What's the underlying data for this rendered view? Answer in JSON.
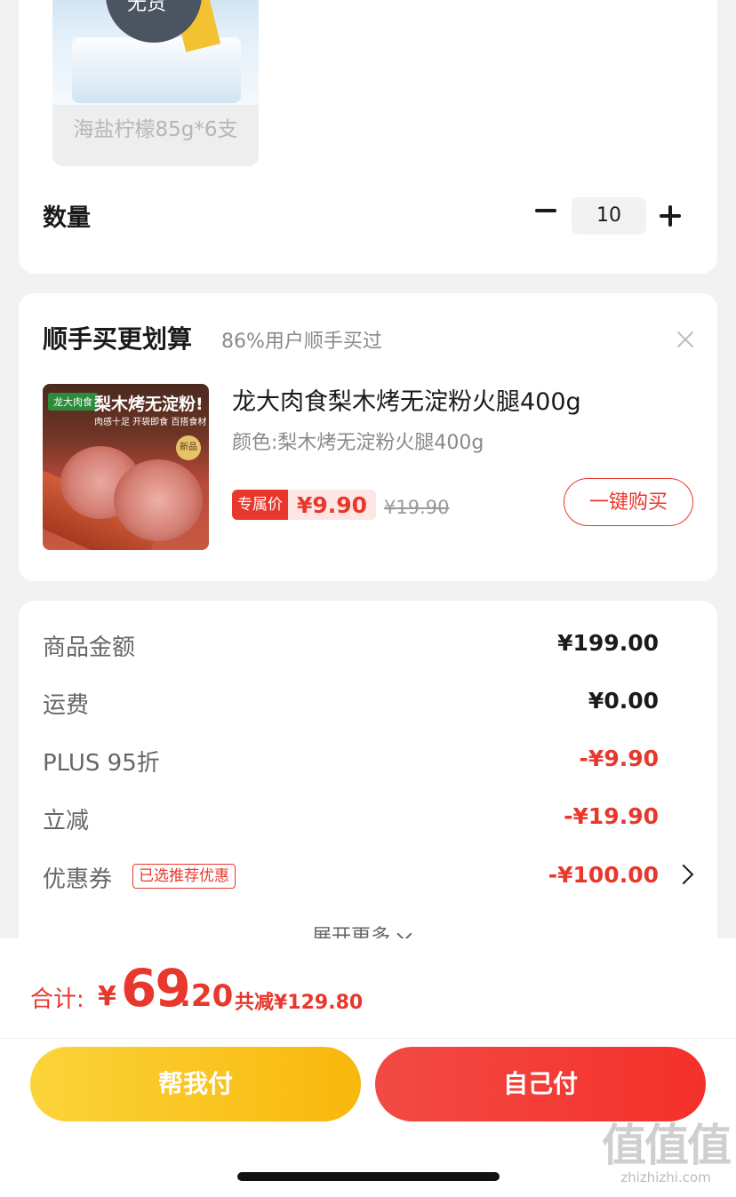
{
  "variant": {
    "badge_text": "无货",
    "label": "海盐柠檬85g*6支"
  },
  "quantity": {
    "label": "数量",
    "value": "10"
  },
  "bundle": {
    "title": "顺手买更划算",
    "subtitle": "86%用户顺手买过",
    "product": {
      "image_brand": "龙大肉食",
      "image_headline": "梨木烤无淀粉!",
      "image_tagline": "肉感十足 开袋即食 百搭食材",
      "image_badge": "新品",
      "name": "龙大肉食梨木烤无淀粉火腿400g",
      "spec": "颜色:梨木烤无淀粉火腿400g",
      "price_label": "专属价",
      "price": "¥9.90",
      "original_price": "¥19.90",
      "buy_label": "一键购买"
    }
  },
  "summary": {
    "rows": [
      {
        "label": "商品金额",
        "value": "¥199.00",
        "color": "#1a1a1a"
      },
      {
        "label": "运费",
        "value": "¥0.00",
        "color": "#1a1a1a"
      },
      {
        "label": "PLUS 95折",
        "value": "-¥9.90",
        "color": "#e8372c"
      },
      {
        "label": "立减",
        "value": "-¥19.90",
        "color": "#e8372c"
      },
      {
        "label": "优惠券",
        "value": "-¥100.00",
        "color": "#e8372c"
      }
    ],
    "coupon_tag": "已选推荐优惠",
    "expand_label": "展开更多"
  },
  "footer": {
    "total_label": "合计:",
    "total_currency": "¥",
    "total_integer": "69",
    "total_decimal": ".20",
    "total_saved": "共减¥129.80",
    "help_pay_label": "帮我付",
    "self_pay_label": "自己付"
  },
  "watermark": {
    "mark": "值值值",
    "site": "zhizhizhi.com"
  },
  "colors": {
    "accent_red": "#e8372c",
    "help_pay_yellow": "#f9b70c",
    "self_pay_red": "#f5302a"
  }
}
